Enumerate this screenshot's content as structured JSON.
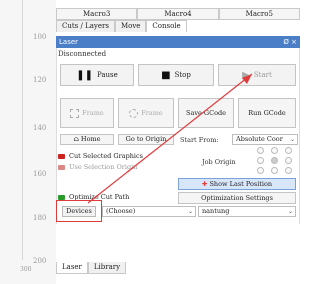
{
  "ruler": {
    "labels": [
      "100",
      "120",
      "140",
      "160",
      "180",
      "200"
    ],
    "bottom_ticks": [
      "300",
      "200"
    ]
  },
  "macros": [
    "Macro3",
    "Macro4",
    "Macro5"
  ],
  "top_tabs": [
    "Cuts / Layers",
    "Move",
    "Console"
  ],
  "laser": {
    "title": "Laser",
    "header_icons": "Ø ×",
    "status": "Disconnected"
  },
  "buttons": {
    "pause": "Pause",
    "stop": "Stop",
    "start": "Start",
    "frame1": "Frame",
    "frame2": "Frame",
    "save_gcode": "Save GCode",
    "run_gcode": "Run GCode",
    "home": "Home",
    "go_to_origin": "Go to Origin",
    "show_last_position": "Show Last Position",
    "optimization_settings": "Optimization Settings",
    "devices": "Devices"
  },
  "start_from": {
    "label": "Start From:",
    "value": "Absolute Coor"
  },
  "job_origin": {
    "label": "Job Origin"
  },
  "checkboxes": [
    {
      "label": "Cut Selected Graphics",
      "color": "#cc2222"
    },
    {
      "label": "Use Selection Origin",
      "color": "#cc2222"
    },
    {
      "label": "Optimize Cut Path",
      "color": "#2a9a2a"
    }
  ],
  "device_select": {
    "value": "(Choose)"
  },
  "port_select": {
    "value": "nantung"
  },
  "bottom_tabs": [
    "Laser",
    "Library"
  ],
  "colors": {
    "header_blue": "#4a7fc8",
    "highlight_red": "#e03b3b",
    "show_last_bg": "#d7e6f9"
  }
}
